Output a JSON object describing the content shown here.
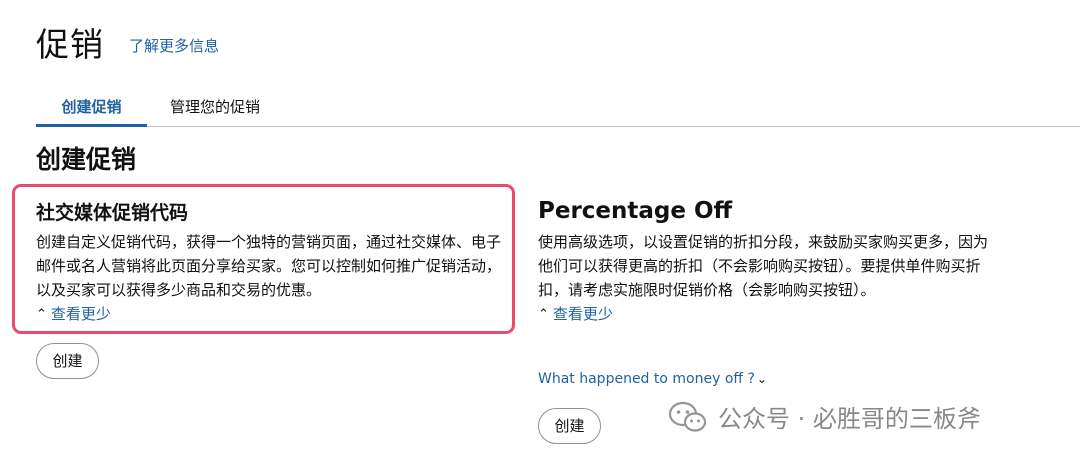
{
  "header": {
    "title": "促销",
    "learn_more": "了解更多信息"
  },
  "tabs": [
    {
      "label": "创建促销",
      "active": true
    },
    {
      "label": "管理您的促销",
      "active": false
    }
  ],
  "section": {
    "heading": "创建促销"
  },
  "cards": [
    {
      "title": "社交媒体促销代码",
      "description": "创建自定义促销代码，获得一个独特的营销页面，通过社交媒体、电子邮件或名人营销将此页面分享给买家。您可以控制如何推广促销活动，以及买家可以获得多少商品和交易的优惠。",
      "see_less": "查看更少",
      "create_button": "创建"
    },
    {
      "title": "Percentage Off",
      "description": "使用高级选项，以设置促销的折扣分段，来鼓励买家购买更多，因为他们可以获得更高的折扣（不会影响购买按钮）。要提供单件购买折扣，请考虑实施限时促销价格（会影响购买按钮）。",
      "see_less": "查看更少",
      "money_off_link": "What happened to money off ?",
      "create_button": "创建"
    }
  ],
  "watermark": {
    "text": "公众号 · 必胜哥的三板斧",
    "icon": "wechat-icon"
  },
  "colors": {
    "link": "#2162a1",
    "highlight_border": "#ea4b6a",
    "text": "#111111"
  }
}
